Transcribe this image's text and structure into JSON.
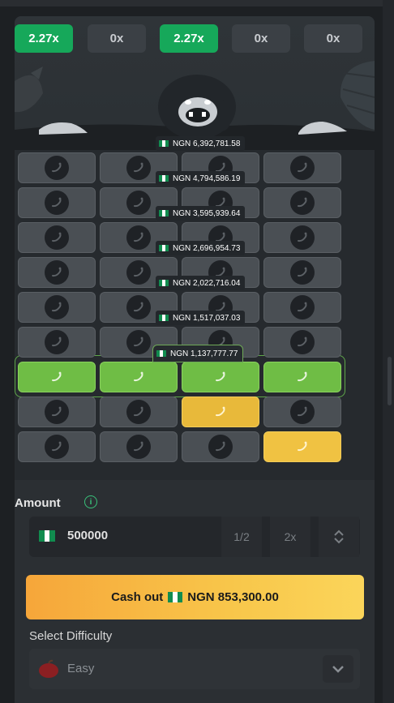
{
  "multipliers": [
    {
      "label": "2.27x",
      "active": true
    },
    {
      "label": "0x",
      "active": false
    },
    {
      "label": "2.27x",
      "active": true
    },
    {
      "label": "0x",
      "active": false
    },
    {
      "label": "0x",
      "active": false
    }
  ],
  "payouts": [
    "NGN 6,392,781.58",
    "NGN 4,794,586.19",
    "NGN 3,595,939.64",
    "NGN 2,696,954.73",
    "NGN 2,022,716.04",
    "NGN 1,517,037.03",
    "NGN 1,137,777.77"
  ],
  "grid": {
    "rows": [
      [
        "hidden",
        "hidden",
        "hidden",
        "hidden"
      ],
      [
        "hidden",
        "hidden",
        "hidden",
        "hidden"
      ],
      [
        "hidden",
        "hidden",
        "hidden",
        "hidden"
      ],
      [
        "hidden",
        "hidden",
        "hidden",
        "hidden"
      ],
      [
        "hidden",
        "hidden",
        "hidden",
        "hidden"
      ],
      [
        "hidden",
        "hidden",
        "hidden",
        "hidden"
      ],
      [
        "green",
        "green",
        "green",
        "green"
      ],
      [
        "hidden",
        "hidden",
        "gold",
        "hidden"
      ],
      [
        "hidden",
        "hidden",
        "hidden",
        "gold"
      ]
    ]
  },
  "amount": {
    "title": "Amount",
    "info_icon": "i",
    "value": "500000",
    "half_label": "1/2",
    "double_label": "2x"
  },
  "cashout": {
    "prefix": "Cash out",
    "value": "NGN 853,300.00"
  },
  "difficulty": {
    "title": "Select Difficulty",
    "selected": "Easy"
  },
  "colors": {
    "accent_green": "#16a85a",
    "tile_green": "#6fbd45",
    "tile_gold": "#e8b93a",
    "cashout_gold": "#f8c64a"
  }
}
